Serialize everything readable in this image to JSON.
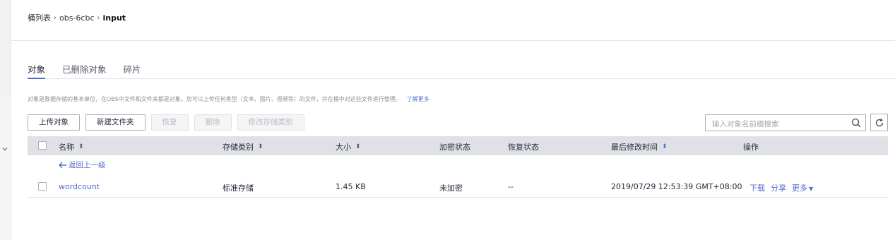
{
  "breadcrumb": {
    "root": "桶列表",
    "bucket": "obs-6cbc",
    "current": "input"
  },
  "tabs": [
    "对象",
    "已删除对象",
    "碎片"
  ],
  "description": {
    "text": "对象是数据存储的基本单位，在OBS中文件和文件夹都是对象。您可以上传任何类型（文本、图片、视频等）的文件，并在桶中对这些文件进行管理。",
    "link": "了解更多"
  },
  "toolbar": {
    "upload": "上传对象",
    "new_folder": "新建文件夹",
    "restore": "恢复",
    "delete": "删除",
    "change_storage": "修改存储类别"
  },
  "search": {
    "placeholder": "输入对象名前缀搜索"
  },
  "columns": {
    "name": "名称",
    "storage": "存储类别",
    "size": "大小",
    "encryption": "加密状态",
    "restore_status": "恢复状态",
    "modified": "最后修改时间",
    "actions": "操作"
  },
  "back_link": "返回上一级",
  "rows": [
    {
      "name": "wordcount",
      "storage": "标准存储",
      "size": "1.45 KB",
      "encryption": "未加密",
      "restore_status": "--",
      "modified": "2019/07/29 12:53:39 GMT+08:00",
      "actions": {
        "download": "下载",
        "share": "分享",
        "more": "更多"
      }
    }
  ],
  "colors": {
    "accent": "#526ecc",
    "header_bg": "#dfe1e6"
  }
}
